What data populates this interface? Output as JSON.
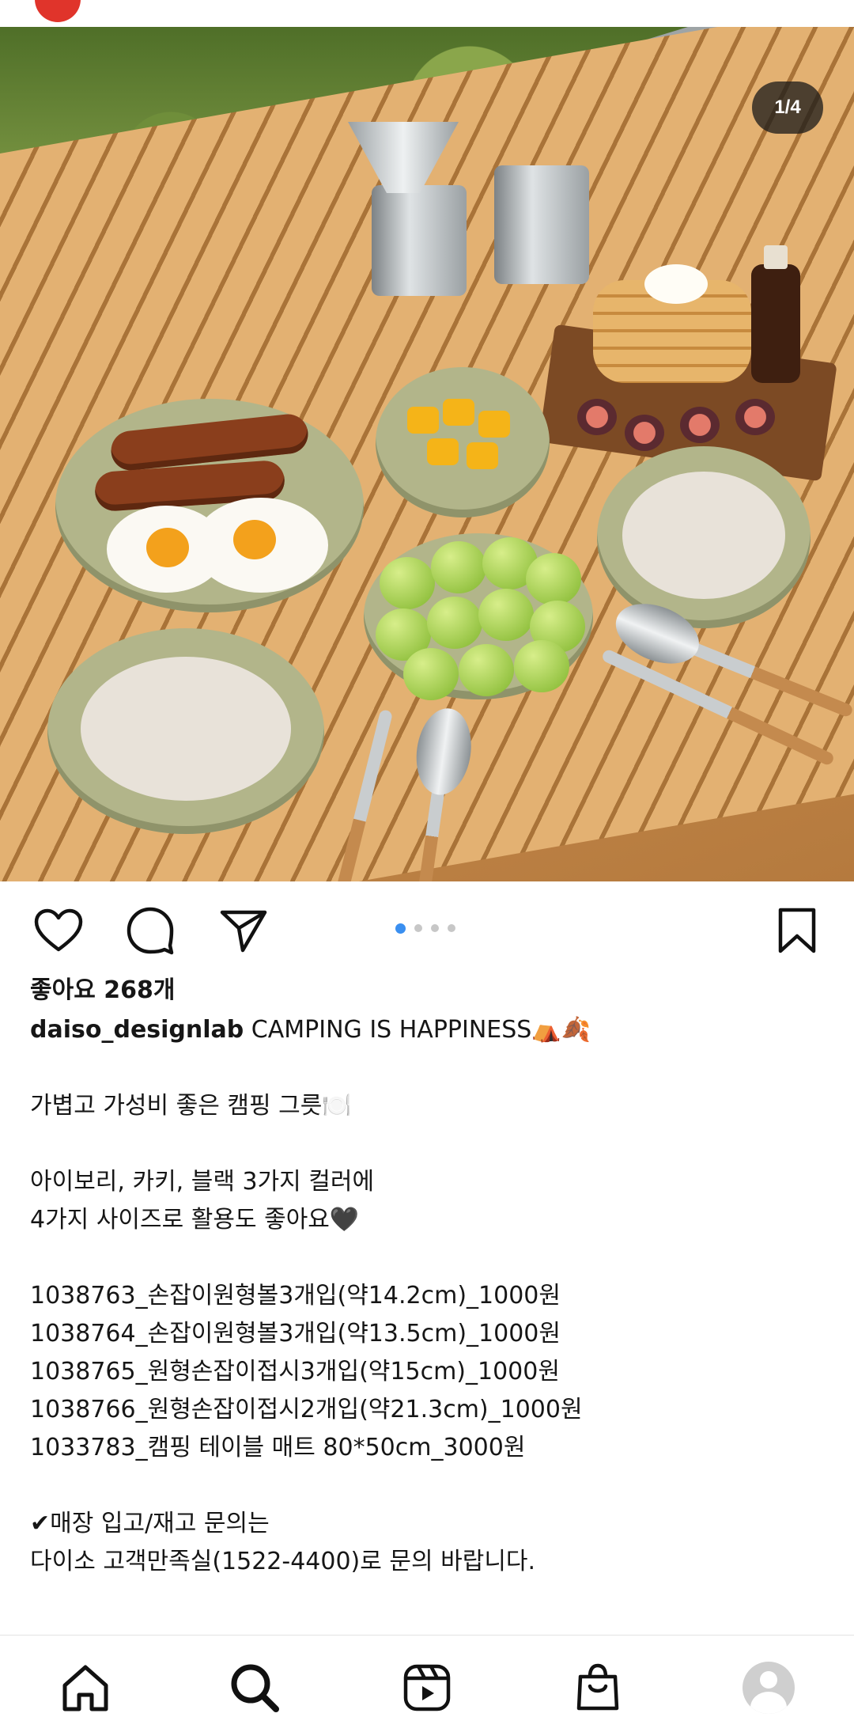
{
  "post": {
    "image_counter": "1/4",
    "image_index": 1,
    "image_total": 4
  },
  "actions": {
    "like_icon": "heart-icon",
    "comment_icon": "comment-icon",
    "share_icon": "paper-plane-icon",
    "save_icon": "bookmark-icon"
  },
  "caption": {
    "likes": "좋아요 268개",
    "username": "daiso_designlab",
    "title_text": " CAMPING IS HAPPINESS⛺🍂",
    "line1": "가볍고 가성비 좋은 캠핑 그릇🍽️",
    "line2": "아이보리, 카키, 블랙 3가지 컬러에",
    "line3": "4가지 사이즈로 활용도 좋아요🖤",
    "products": [
      "1038763_손잡이원형볼3개입(약14.2cm)_1000원",
      "1038764_손잡이원형볼3개입(약13.5cm)_1000원",
      "1038765_원형손잡이접시3개입(약15cm)_1000원",
      "1038766_원형손잡이접시2개입(약21.3cm)_1000원",
      "1033783_캠핑 테이블 매트 80*50cm_3000원"
    ],
    "notice1": "✔매장 입고/재고 문의는",
    "notice2": "다이소 고객만족실(1522-4400)로 문의 바랍니다."
  },
  "nav": {
    "home_icon": "home-icon",
    "search_icon": "search-icon",
    "reels_icon": "reels-icon",
    "shop_icon": "shopping-bag-icon",
    "profile_icon": "profile-avatar"
  },
  "colors": {
    "accent_blue": "#3a8ff0",
    "inactive_dot": "#c7c7c7",
    "text": "#161616"
  }
}
